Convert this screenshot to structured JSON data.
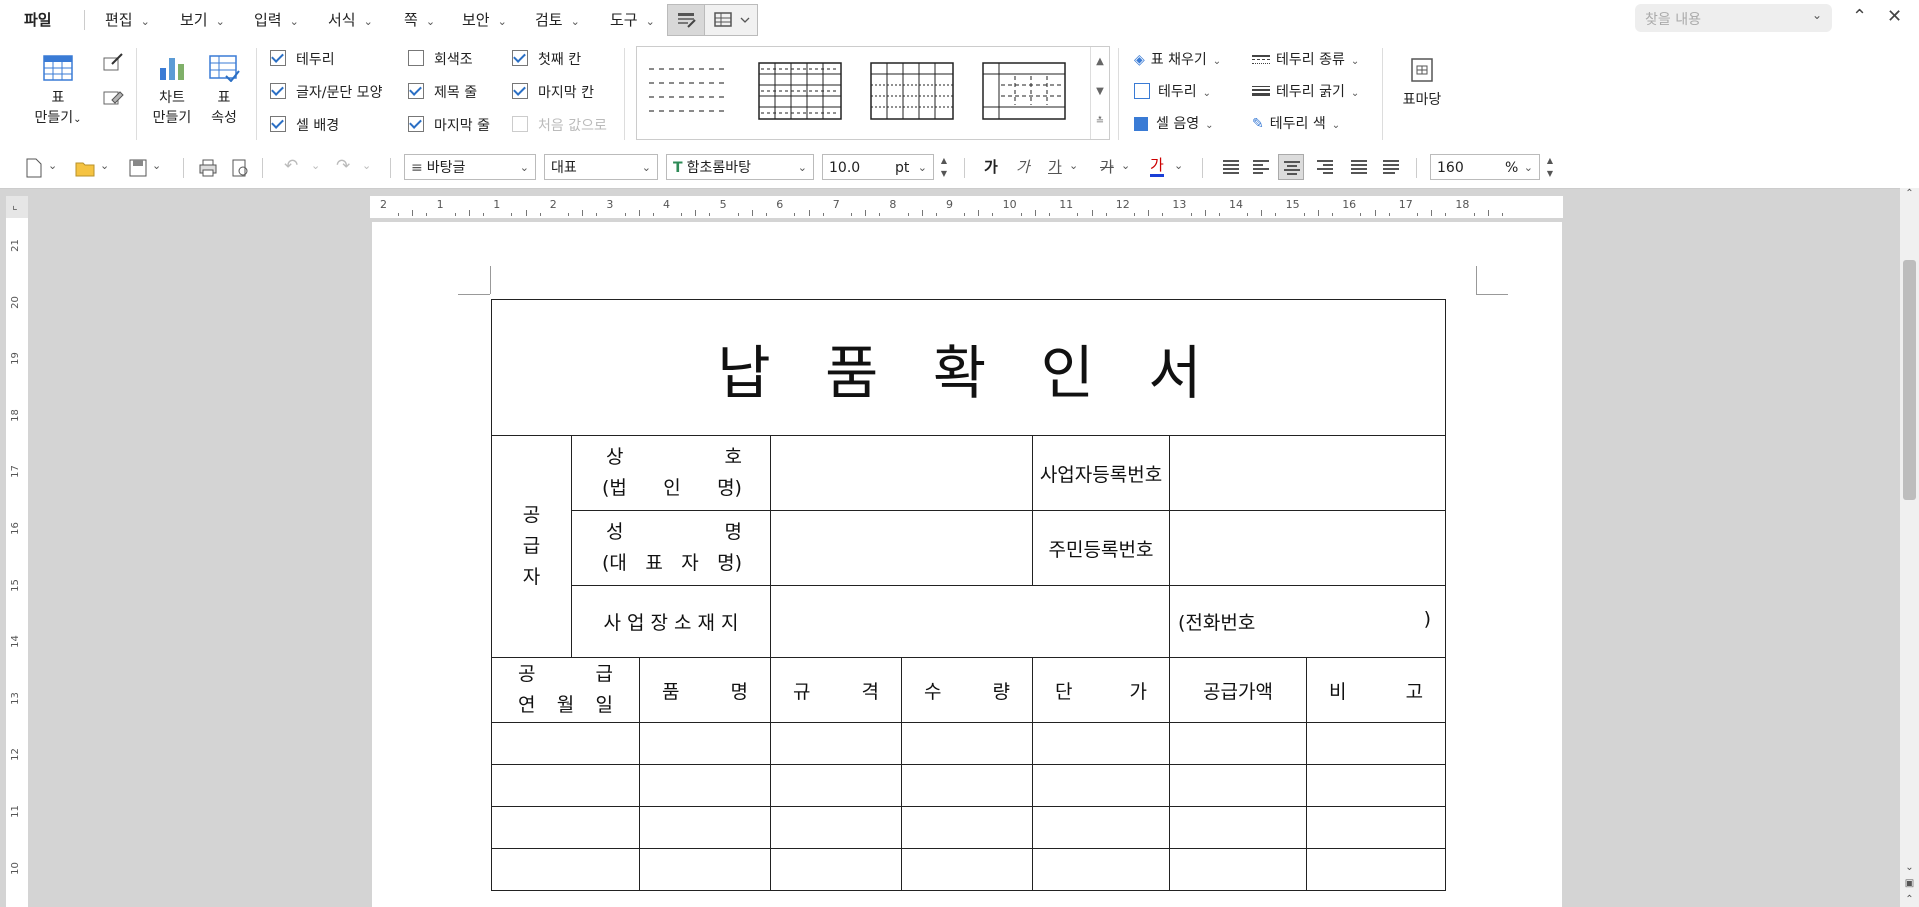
{
  "menu": {
    "file": "파일",
    "items": [
      {
        "label": "편집"
      },
      {
        "label": "보기"
      },
      {
        "label": "입력"
      },
      {
        "label": "서식"
      },
      {
        "label": "쪽"
      },
      {
        "label": "보안"
      },
      {
        "label": "검토"
      },
      {
        "label": "도구"
      }
    ],
    "search_placeholder": "찾을 내용"
  },
  "ribbon": {
    "table_make": [
      "표",
      "만들기"
    ],
    "chart_make": [
      "차트",
      "만들기"
    ],
    "table_props": [
      "표",
      "속성"
    ],
    "checks": [
      {
        "label": "테두리",
        "checked": true
      },
      {
        "label": "글자/문단 모양",
        "checked": true
      },
      {
        "label": "셀 배경",
        "checked": true
      },
      {
        "label": "회색조",
        "checked": false
      },
      {
        "label": "제목 줄",
        "checked": true
      },
      {
        "label": "마지막 줄",
        "checked": true
      },
      {
        "label": "첫째 칸",
        "checked": true
      },
      {
        "label": "마지막 칸",
        "checked": true
      },
      {
        "label": "처음 값으로",
        "checked": false,
        "disabled": true
      }
    ],
    "fill": "표 채우기",
    "border": "테두리",
    "cell_shade": "셀 음영",
    "border_type": "테두리 종류",
    "border_width": "테두리 굵기",
    "border_color": "테두리 색",
    "table_stamp": "표마당"
  },
  "toolbar": {
    "para_style": "바탕글",
    "style_name": "대표",
    "font": "함초롬바탕",
    "font_size": "10.0",
    "size_unit": "pt",
    "zoom": "160",
    "zoom_unit": "%",
    "bold": "가",
    "italic": "가",
    "underline": "가",
    "strike": "가",
    "font_color_glyph": "가"
  },
  "ruler": {
    "h_ticks": [
      "2",
      "1",
      "1",
      "2",
      "3",
      "4",
      "5",
      "6",
      "7",
      "8",
      "9",
      "10",
      "11",
      "12",
      "13",
      "14",
      "15",
      "16",
      "17",
      "18"
    ],
    "v_ticks": [
      "21",
      "20",
      "19",
      "18",
      "17",
      "16",
      "15",
      "14",
      "13",
      "12",
      "11",
      "10"
    ]
  },
  "document": {
    "title": "납 품 확 인 서",
    "supplier": "공\n급\n자",
    "company_a": "상",
    "company_b": "호",
    "company_c": "(법",
    "company_d": "인",
    "company_e": "명)",
    "biz_reg": "사업자등록번호",
    "name_a": "성",
    "name_b": "명",
    "name_c": "(대",
    "name_d": "표",
    "name_e": "자",
    "name_f": "명)",
    "resident_reg": "주민등록번호",
    "address": "사 업 장 소 재 지",
    "phone_open": "(전화번호",
    "phone_close": ")",
    "headers": {
      "date_a": "공",
      "date_b": "급",
      "date_c": "연",
      "date_d": "월",
      "date_e": "일",
      "item_a": "품",
      "item_b": "명",
      "spec_a": "규",
      "spec_b": "격",
      "qty_a": "수",
      "qty_b": "량",
      "price_a": "단",
      "price_b": "가",
      "amount": "공급가액",
      "note_a": "비",
      "note_b": "고"
    }
  }
}
